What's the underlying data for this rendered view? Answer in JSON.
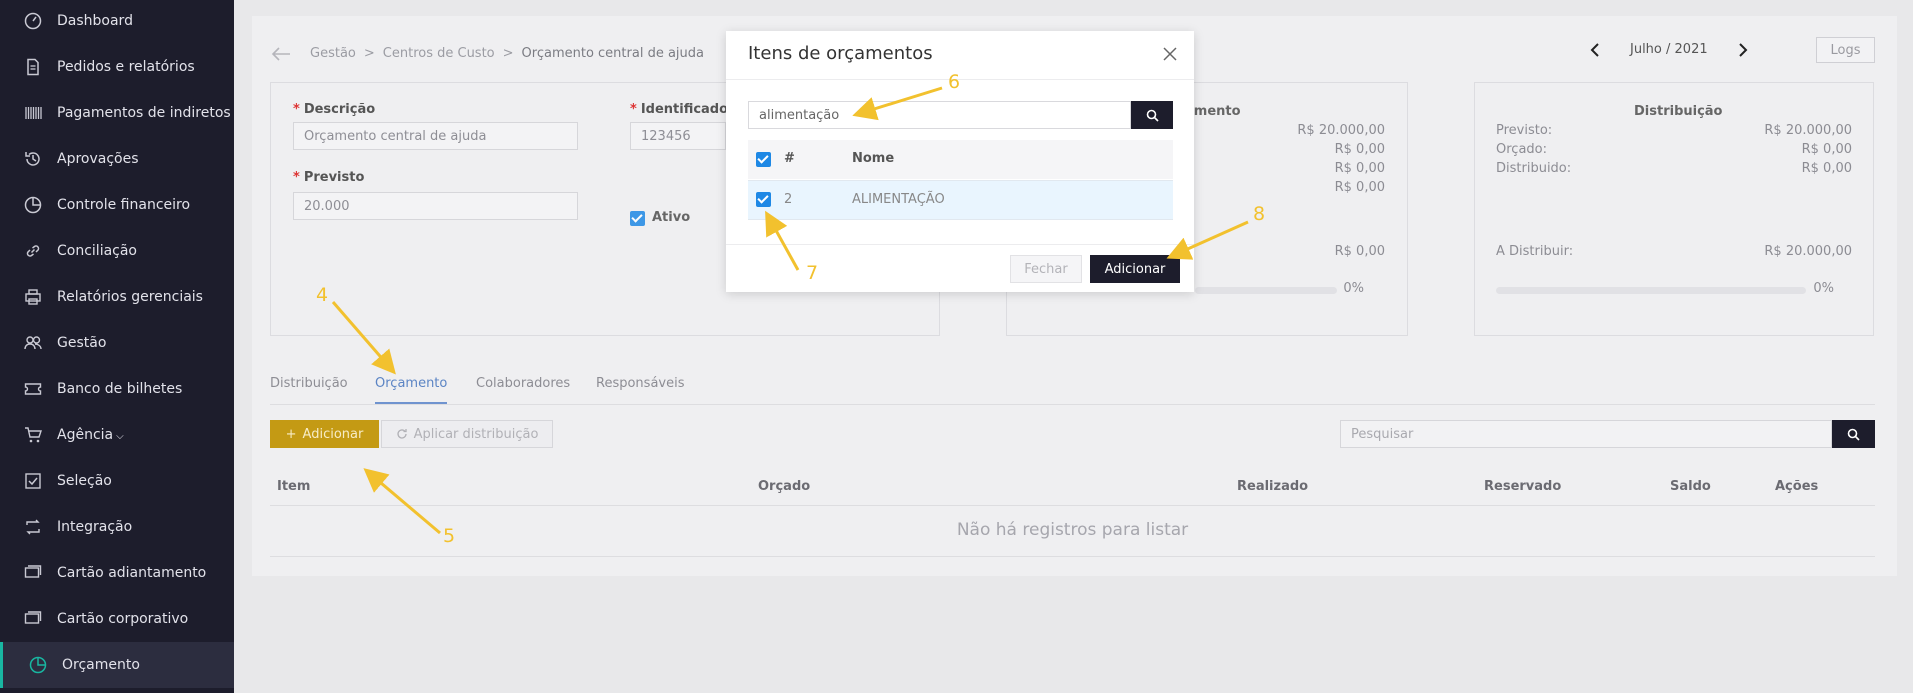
{
  "sidebar": {
    "items": [
      {
        "label": "Dashboard",
        "icon": "dashboard-icon"
      },
      {
        "label": "Pedidos e relatórios",
        "icon": "document-icon"
      },
      {
        "label": "Pagamentos de indiretos",
        "icon": "barcode-icon"
      },
      {
        "label": "Aprovações",
        "icon": "history-icon"
      },
      {
        "label": "Controle financeiro",
        "icon": "pie-chart-icon"
      },
      {
        "label": "Conciliação",
        "icon": "link-icon"
      },
      {
        "label": "Relatórios gerenciais",
        "icon": "printer-icon"
      },
      {
        "label": "Gestão",
        "icon": "users-icon"
      },
      {
        "label": "Banco de bilhetes",
        "icon": "ticket-icon"
      },
      {
        "label": "Agência",
        "icon": "cart-icon"
      },
      {
        "label": "Seleção",
        "icon": "checkbox-icon"
      },
      {
        "label": "Integração",
        "icon": "sync-icon"
      },
      {
        "label": "Cartão adiantamento",
        "icon": "card-icon"
      },
      {
        "label": "Cartão corporativo",
        "icon": "card-icon"
      },
      {
        "label": "Orçamento",
        "icon": "pie-chart-icon"
      }
    ],
    "active": "Orçamento"
  },
  "breadcrumb": {
    "items": [
      "Gestão",
      "Centros de Custo",
      "Orçamento central de ajuda"
    ],
    "separator": ">"
  },
  "month_nav": {
    "label": "Julho / 2021"
  },
  "logs_label": "Logs",
  "form": {
    "descricao_label": "Descrição",
    "descricao_value": "Orçamento central de ajuda",
    "identificador_label": "Identificador",
    "identificador_value": "123456",
    "previsto_label": "Previsto",
    "previsto_value": "20.000",
    "ativo_label": "Ativo",
    "required_mark": "*"
  },
  "orcamento_box": {
    "title_fragment": "amento",
    "values": [
      "R$ 20.000,00",
      "R$ 0,00",
      "R$ 0,00",
      "R$ 0,00"
    ],
    "bottom_value": "R$ 0,00",
    "percent": "0%"
  },
  "distribuicao_box": {
    "title": "Distribuição",
    "rows": [
      {
        "label": "Previsto:",
        "value": "R$ 20.000,00"
      },
      {
        "label": "Orçado:",
        "value": "R$ 0,00"
      },
      {
        "label": "Distribuido:",
        "value": "R$ 0,00"
      }
    ],
    "a_distribuir_label": "A Distribuir:",
    "a_distribuir_value": "R$ 20.000,00",
    "percent": "0%"
  },
  "tabs": [
    "Distribuição",
    "Orçamento",
    "Colaboradores",
    "Responsáveis"
  ],
  "active_tab": "Orçamento",
  "actions": {
    "add_label": "Adicionar",
    "apply_label": "Aplicar distribuição",
    "search_placeholder": "Pesquisar"
  },
  "table": {
    "headers": [
      "Item",
      "Orçado",
      "Realizado",
      "Reservado",
      "Saldo",
      "Ações"
    ],
    "empty_message": "Não há registros para listar"
  },
  "modal": {
    "title": "Itens de orçamentos",
    "search_value": "alimentação",
    "headers": [
      "#",
      "Nome"
    ],
    "rows": [
      {
        "id": "2",
        "name": "ALIMENTAÇÃO",
        "checked": true
      }
    ],
    "close_label": "Fechar",
    "add_label": "Adicionar"
  },
  "annotations": [
    "4",
    "5",
    "6",
    "7",
    "8"
  ],
  "colors": {
    "sidebar_bg": "#1d1d2c",
    "accent_teal": "#19b6a1",
    "add_btn": "#c49a14",
    "checkbox": "#1e88e5",
    "annotation": "#f2c12e"
  }
}
